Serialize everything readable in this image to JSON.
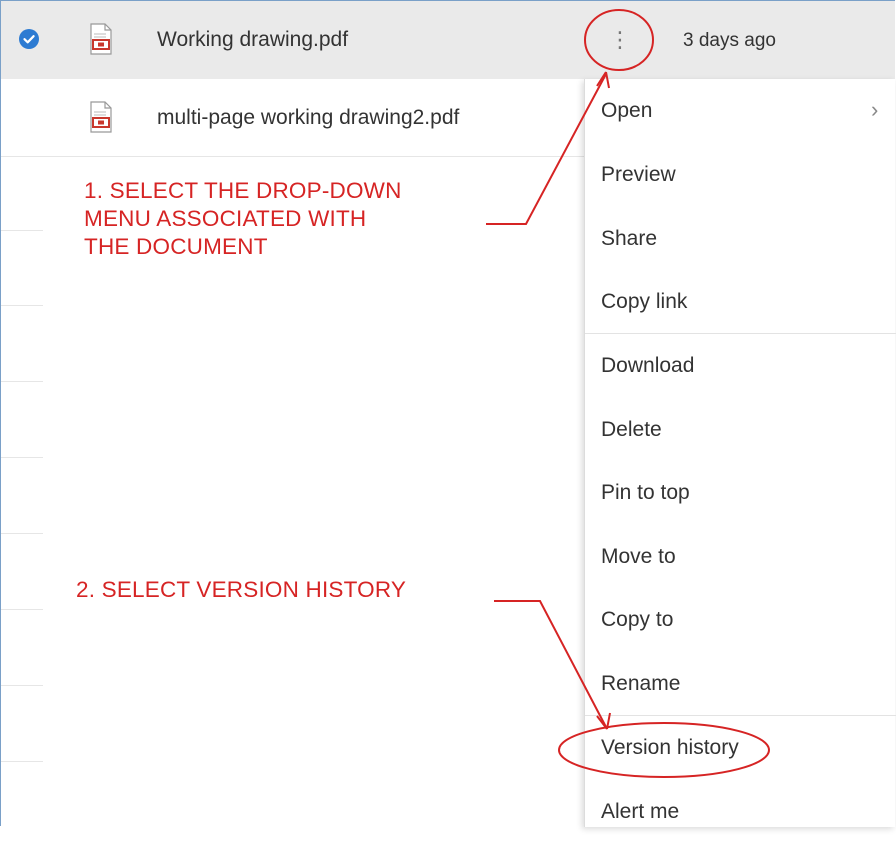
{
  "files": [
    {
      "name": "Working drawing.pdf",
      "modified": "3 days ago",
      "selected": true
    },
    {
      "name": "multi-page working drawing2.pdf",
      "modified": "",
      "selected": false
    }
  ],
  "more_button_glyph": "⋮",
  "context_menu": {
    "items": [
      {
        "label": "Open",
        "submenu": true
      },
      {
        "label": "Preview"
      },
      {
        "label": "Share"
      },
      {
        "label": "Copy link"
      },
      {
        "label": "Download"
      },
      {
        "label": "Delete"
      },
      {
        "label": "Pin to top"
      },
      {
        "label": "Move to"
      },
      {
        "label": "Copy to"
      },
      {
        "label": "Rename"
      },
      {
        "label": "Version history"
      },
      {
        "label": "Alert me"
      }
    ],
    "submenu_glyph": "›"
  },
  "annotations": {
    "step1_line1": "1. SELECT THE DROP-DOWN",
    "step1_line2": "MENU ASSOCIATED WITH",
    "step1_line3": "THE DOCUMENT",
    "step2": "2. SELECT VERSION HISTORY"
  },
  "colors": {
    "accent_check": "#2d7bd2",
    "annotation_red": "#d62424",
    "selected_row_bg": "#eaeaea",
    "pdf_icon_red": "#c9372c"
  },
  "icons": [
    "checkmark-icon",
    "pdf-file-icon",
    "more-vertical-icon",
    "chevron-right-icon"
  ]
}
